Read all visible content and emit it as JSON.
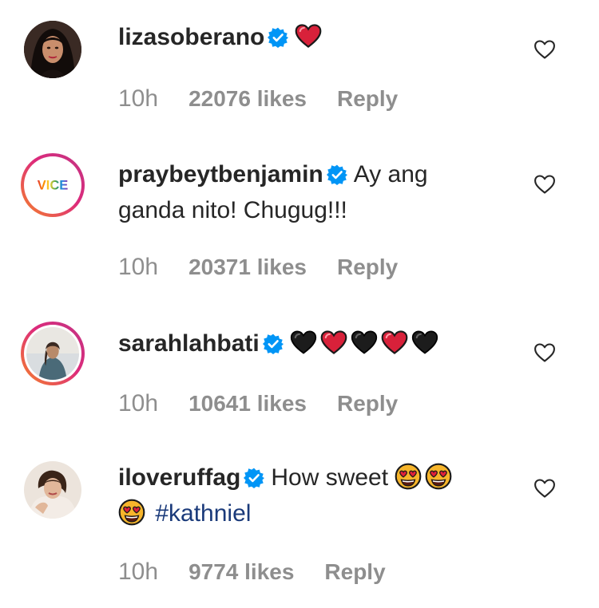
{
  "comments": [
    {
      "username": "lizasoberano",
      "text": "",
      "hashtag": "",
      "time": "10h",
      "likes": "22076 likes",
      "reply_label": "Reply",
      "emojis": [
        "red-heart-emoji"
      ]
    },
    {
      "username": "praybeytbenjamin",
      "text": "Ay ang ganda nito! Chugug!!!",
      "hashtag": "",
      "time": "10h",
      "likes": "20371 likes",
      "reply_label": "Reply",
      "avatar_text": "VICE",
      "emojis": []
    },
    {
      "username": "sarahlahbati",
      "text": "",
      "hashtag": "",
      "time": "10h",
      "likes": "10641 likes",
      "reply_label": "Reply",
      "emojis": [
        "black-heart-emoji",
        "red-heart-emoji",
        "black-heart-emoji",
        "red-heart-emoji",
        "black-heart-emoji"
      ]
    },
    {
      "username": "iloveruffag",
      "text": "How sweet",
      "hashtag": "#kathniel",
      "time": "10h",
      "likes": "9774 likes",
      "reply_label": "Reply",
      "emojis": [
        "heart-eyes-emoji",
        "heart-eyes-emoji",
        "heart-eyes-emoji"
      ]
    }
  ],
  "colors": {
    "verified": "#0095f6",
    "meta": "#8e8e8e",
    "hashtag": "#1a3a7a",
    "red_heart": "#d8213a",
    "black_heart": "#1c1c1c"
  }
}
